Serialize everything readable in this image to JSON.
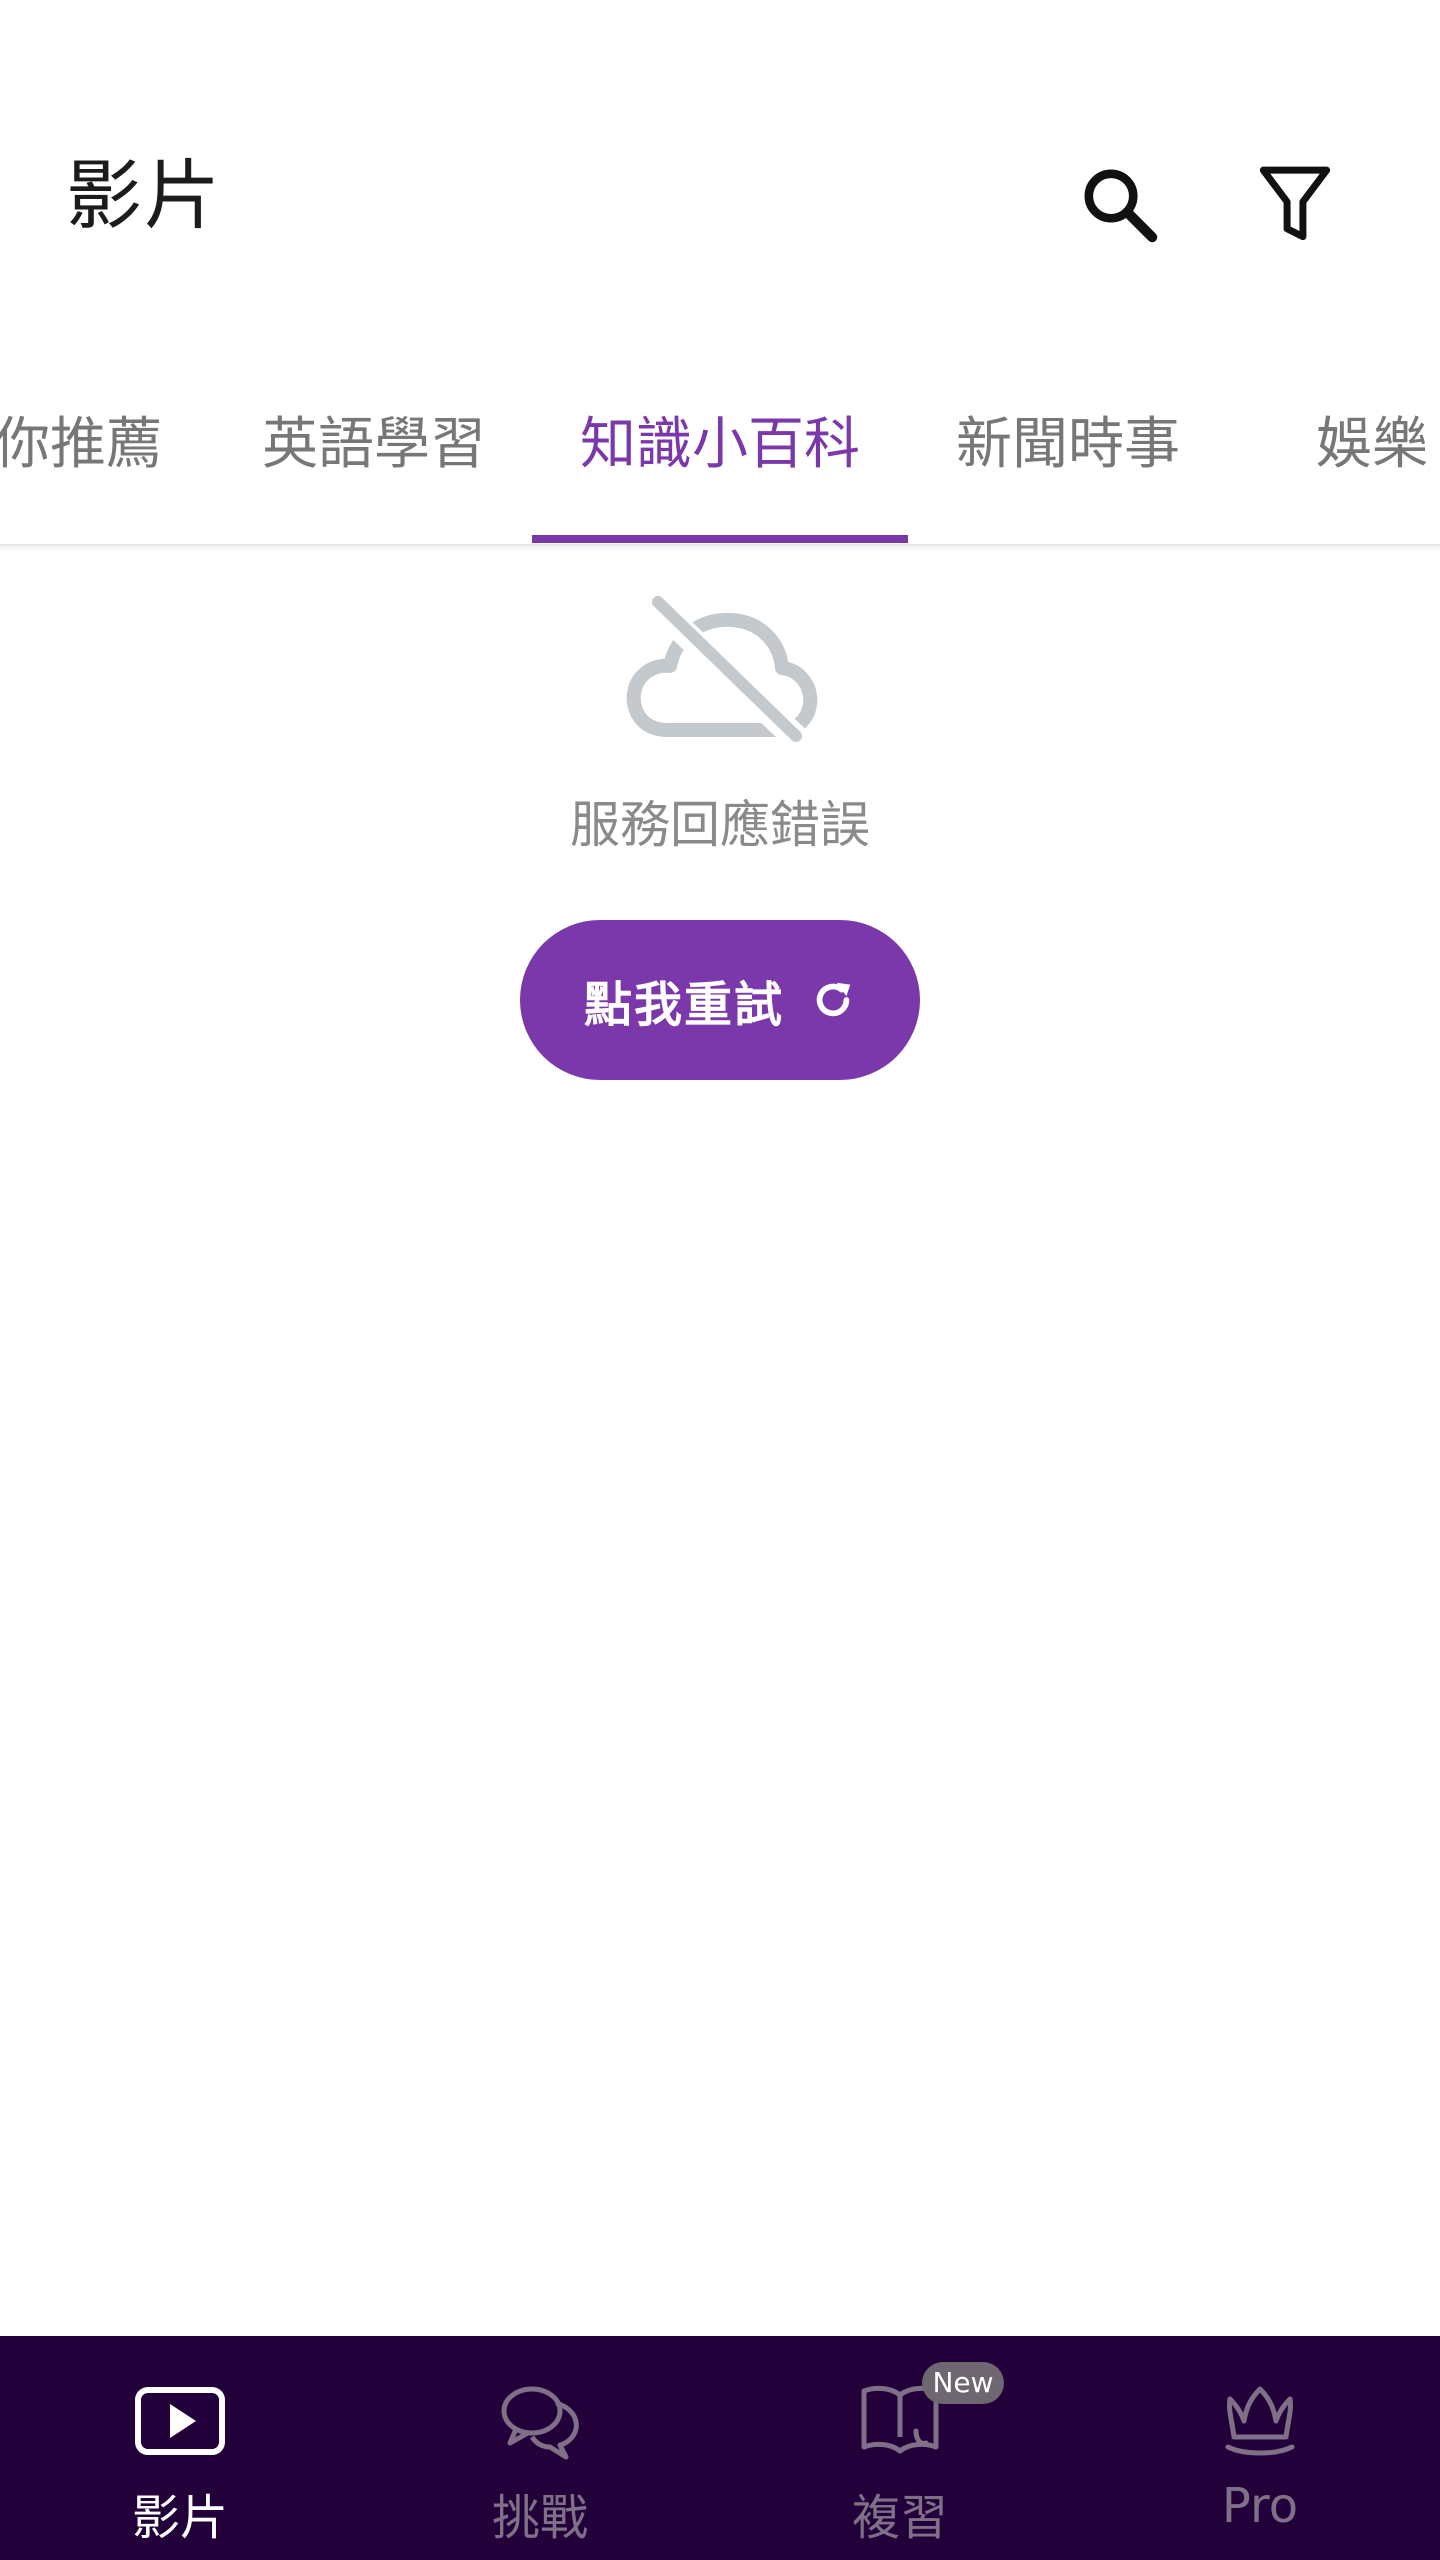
{
  "header": {
    "title": "影片",
    "search_icon": "search-icon",
    "filter_icon": "filter-icon"
  },
  "tabs": [
    {
      "label": "你推薦",
      "active": false
    },
    {
      "label": "英語學習",
      "active": false
    },
    {
      "label": "知識小百科",
      "active": true
    },
    {
      "label": "新聞時事",
      "active": false
    },
    {
      "label": "娛樂",
      "active": false
    }
  ],
  "error": {
    "icon": "cloud-off-icon",
    "message": "服務回應錯誤",
    "retry_label": "點我重試",
    "retry_icon": "refresh-icon"
  },
  "bottom_nav": {
    "items": [
      {
        "label": "影片",
        "icon": "play-video-icon",
        "active": true
      },
      {
        "label": "挑戰",
        "icon": "chat-bubbles-icon",
        "active": false
      },
      {
        "label": "複習",
        "icon": "book-icon",
        "active": false,
        "badge": "New"
      },
      {
        "label": "Pro",
        "icon": "crown-icon",
        "active": false
      }
    ]
  },
  "colors": {
    "accent": "#7b38ab",
    "nav_background": "#22003a",
    "inactive_text": "#777777"
  }
}
